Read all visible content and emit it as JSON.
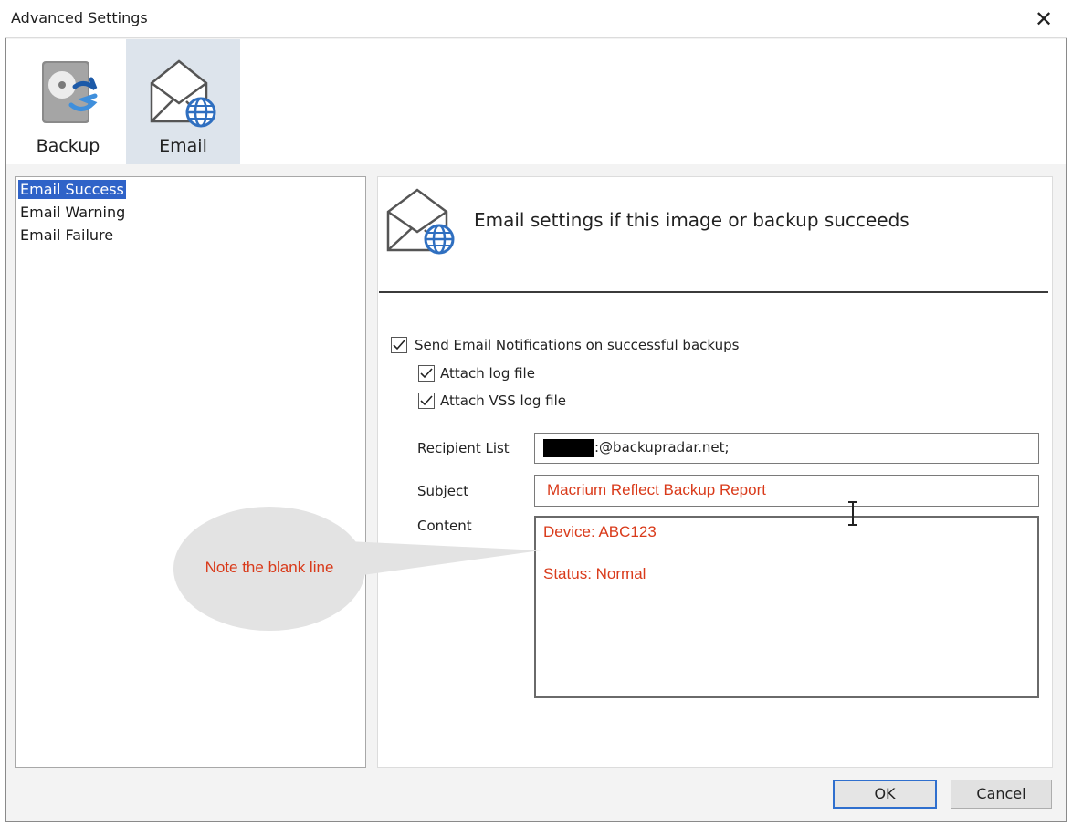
{
  "window": {
    "title": "Advanced Settings",
    "close_glyph": "✕"
  },
  "toolbar": {
    "items": [
      {
        "label": "Backup",
        "icon": "backup-disk-icon"
      },
      {
        "label": "Email",
        "icon": "email-globe-icon",
        "selected": true
      }
    ]
  },
  "sidebar": {
    "items": [
      {
        "label": "Email Success",
        "selected": true
      },
      {
        "label": "Email Warning"
      },
      {
        "label": "Email Failure"
      }
    ]
  },
  "main": {
    "header": "Email settings if this image or backup succeeds",
    "send_notifications": {
      "label": "Send Email Notifications on successful backups",
      "checked": true
    },
    "attach_log": {
      "label": "Attach log file",
      "checked": true
    },
    "attach_vss": {
      "label": "Attach VSS log file",
      "checked": true
    },
    "recipient": {
      "label": "Recipient List",
      "value": ":@backupradar.net;"
    },
    "subject": {
      "label": "Subject",
      "value": "Macrium Reflect Backup Report"
    },
    "content": {
      "label": "Content",
      "line1": "Device: ABC123",
      "line2": "Status: Normal"
    }
  },
  "callout": {
    "text": "Note the blank line"
  },
  "buttons": {
    "ok": "OK",
    "cancel": "Cancel"
  },
  "colors": {
    "accent": "#2f63c8",
    "annotation": "#d93a1a",
    "selected_tool": "#dde4ec"
  }
}
